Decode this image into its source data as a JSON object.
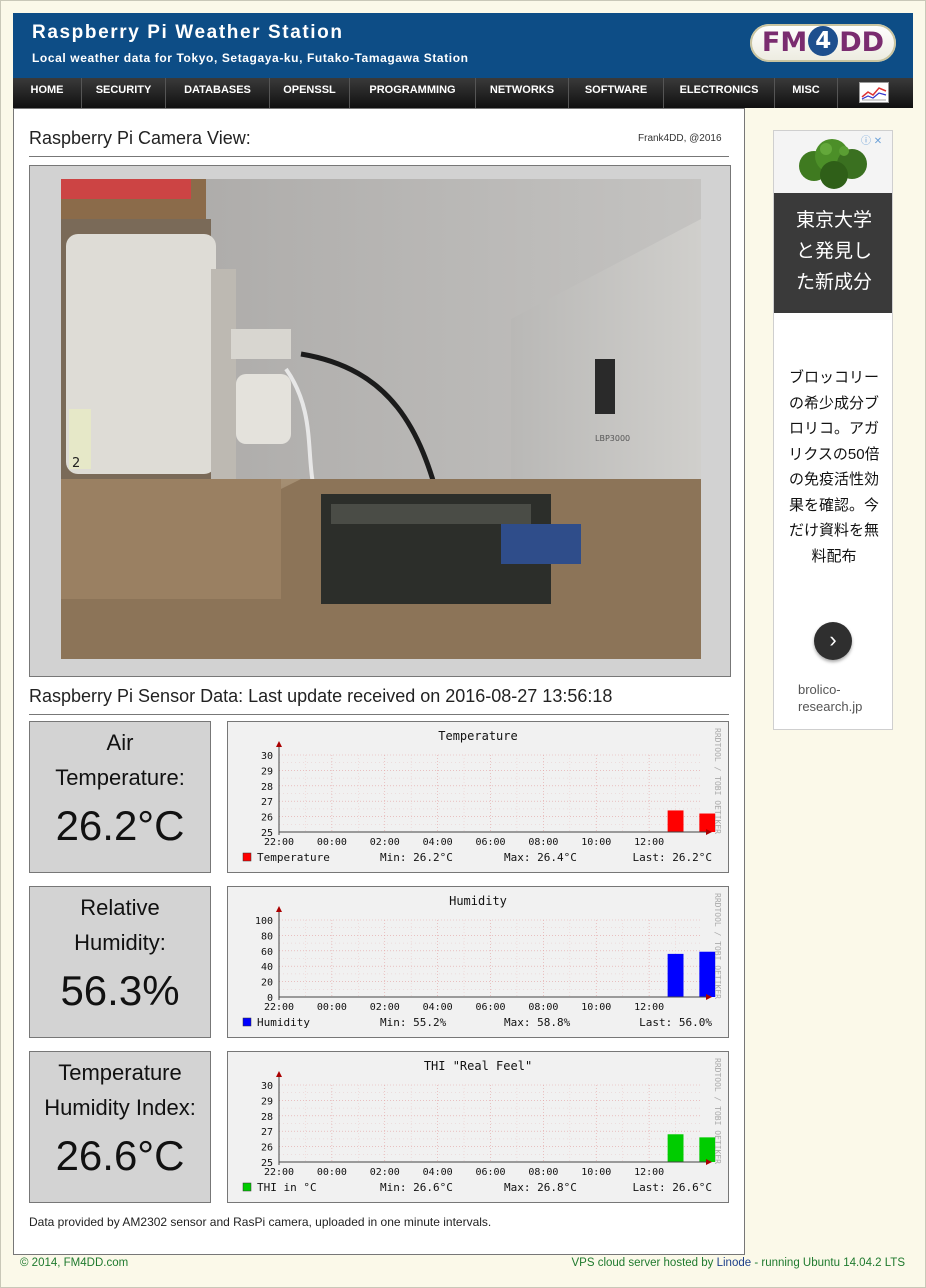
{
  "header": {
    "title": "Raspberry Pi Weather Station",
    "subtitle": "Local weather data for Tokyo, Setagaya-ku, Futako-Tamagawa Station",
    "logo_text": {
      "part1": "FM",
      "part2": "4",
      "part3": "DD"
    }
  },
  "nav": {
    "items": [
      "HOME",
      "SECURITY",
      "DATABASES",
      "OPENSSL",
      "PROGRAMMING",
      "NETWORKS",
      "SOFTWARE",
      "ELECTRONICS",
      "MISC"
    ]
  },
  "camera": {
    "title": "Raspberry Pi Camera View:",
    "credit": "Frank4DD, @2016",
    "label_on_case": "2",
    "printer_label": "LBP3000"
  },
  "sensor": {
    "title": "Raspberry Pi Sensor Data: Last update received on 2016-08-27 13:56:18",
    "metrics": [
      {
        "label_line1": "Air",
        "label_line2": "Temperature:",
        "value": "26.2°C"
      },
      {
        "label_line1": "Relative",
        "label_line2": "Humidity:",
        "value": "56.3%"
      },
      {
        "label_line1": "Temperature",
        "label_line2": "Humidity Index:",
        "value": "26.6°C"
      }
    ],
    "footnote": "Data provided by AM2302 sensor and RasPi camera, uploaded in one minute intervals."
  },
  "chart_data": [
    {
      "type": "bar",
      "title": "Temperature",
      "watermark": "RRDTOOL / TOBI OETIKER",
      "x_ticks": [
        "22:00",
        "00:00",
        "02:00",
        "04:00",
        "06:00",
        "08:00",
        "10:00",
        "12:00"
      ],
      "y_ticks": [
        "25",
        "26",
        "27",
        "28",
        "29",
        "30"
      ],
      "ylim": [
        25,
        30
      ],
      "series": [
        {
          "name": "Temperature",
          "color": "#ff0000",
          "hours": [
            14.7,
            15.9
          ],
          "values": [
            26.4,
            26.2
          ]
        }
      ],
      "legend": {
        "name": "Temperature",
        "min": "Min: 26.2°C",
        "max": "Max: 26.4°C",
        "last": "Last: 26.2°C"
      }
    },
    {
      "type": "bar",
      "title": "Humidity",
      "watermark": "RRDTOOL / TOBI OETIKER",
      "x_ticks": [
        "22:00",
        "00:00",
        "02:00",
        "04:00",
        "06:00",
        "08:00",
        "10:00",
        "12:00"
      ],
      "y_ticks": [
        "0",
        "20",
        "40",
        "60",
        "80",
        "100"
      ],
      "ylim": [
        0,
        100
      ],
      "series": [
        {
          "name": "Humidity",
          "color": "#0000ff",
          "hours": [
            14.7,
            15.9
          ],
          "values": [
            56.0,
            58.8
          ]
        }
      ],
      "legend": {
        "name": "Humidity",
        "min": "Min: 55.2%",
        "max": "Max: 58.8%",
        "last": "Last: 56.0%"
      }
    },
    {
      "type": "bar",
      "title": "THI \"Real Feel\"",
      "watermark": "RRDTOOL / TOBI OETIKER",
      "x_ticks": [
        "22:00",
        "00:00",
        "02:00",
        "04:00",
        "06:00",
        "08:00",
        "10:00",
        "12:00"
      ],
      "y_ticks": [
        "25",
        "26",
        "27",
        "28",
        "29",
        "30"
      ],
      "ylim": [
        25,
        30
      ],
      "series": [
        {
          "name": "THI in °C",
          "color": "#00cc00",
          "hours": [
            14.7,
            15.9
          ],
          "values": [
            26.8,
            26.6
          ]
        }
      ],
      "legend": {
        "name": "THI in °C",
        "min": "Min: 26.6°C",
        "max": "Max: 26.8°C",
        "last": "Last: 26.6°C"
      }
    }
  ],
  "ad": {
    "headline": "東京大学と発見した新成分",
    "body": "ブロッコリーの希少成分ブロリコ。アガリクスの50倍の免疫活性効果を確認。今だけ資料を無料配布",
    "domain": "brolico-research.jp",
    "arrow": "›",
    "info_icon": "ⓘ",
    "close_icon": "✕"
  },
  "footer": {
    "left": "© 2014, FM4DD.com",
    "right_prefix": "VPS cloud server hosted by ",
    "right_link": "Linode",
    "right_suffix": " - running Ubuntu 14.04.2 LTS"
  },
  "colors": {
    "header_bg": "#0d4d86",
    "page_bg": "#fbf9e9",
    "footer_text": "#1f7a2e"
  }
}
